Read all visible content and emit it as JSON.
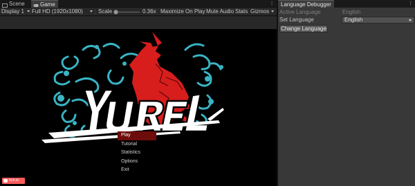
{
  "tabs": {
    "scene": "Scene",
    "game": "Game"
  },
  "toolbar": {
    "display": "Display 1",
    "resolution": "Full HD (1920x1080)",
    "scale_label": "Scale",
    "scale_value": "0.36x",
    "maximize": "Maximize On Play",
    "mute": "Mute Audio",
    "stats": "Stats",
    "gizmos": "Gizmos"
  },
  "game": {
    "logo_text": "YUREL",
    "menu": [
      "Play",
      "Tutorial",
      "Statistics",
      "Options",
      "Exit"
    ],
    "selected_index": 0,
    "badge": "itch.io"
  },
  "debugger": {
    "title": "Language Debugger",
    "active_label": "Active Language",
    "active_value": "English",
    "set_label": "Set Language",
    "set_value": "English",
    "button": "Change Language"
  },
  "colors": {
    "accent_red": "#d81d1d",
    "teal": "#39b4c3",
    "menu_highlight": "#6e0b0b",
    "itch_red": "#fa5c5c"
  }
}
